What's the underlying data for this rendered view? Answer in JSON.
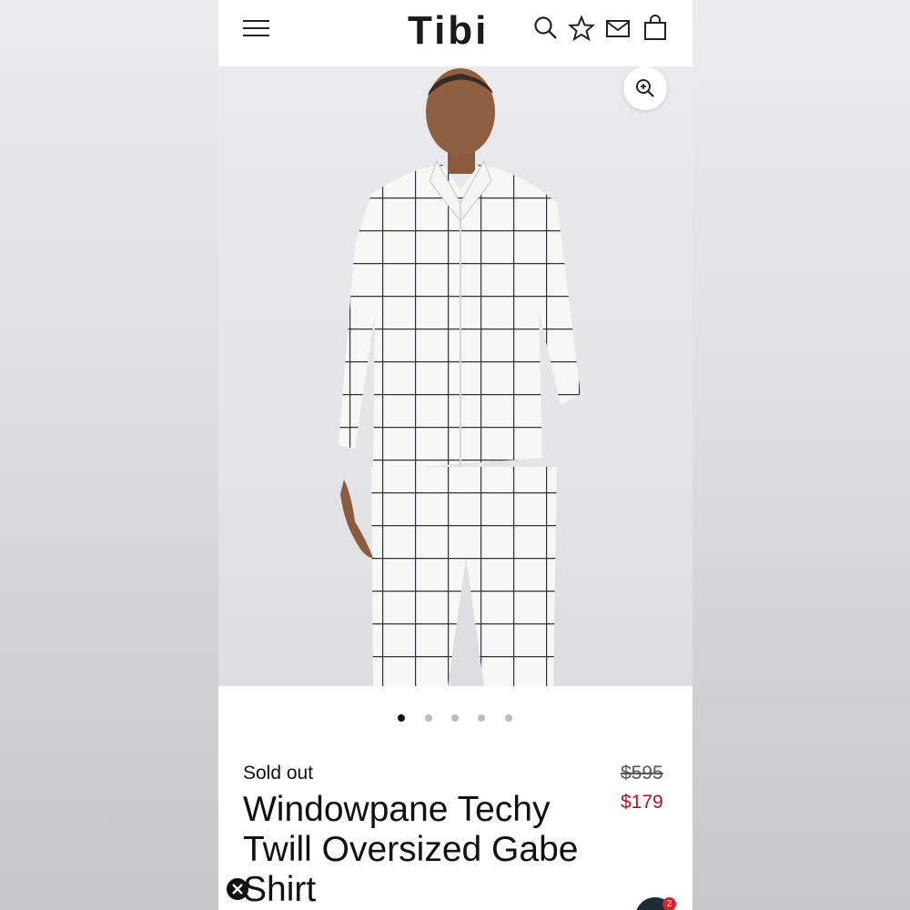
{
  "header": {
    "brand": "Tibi",
    "icons": [
      "menu-icon",
      "search-icon",
      "star-icon",
      "mail-icon",
      "bag-icon"
    ]
  },
  "gallery": {
    "zoom_icon": "zoom-in-icon",
    "dots_total": 5,
    "active_index": 0
  },
  "product": {
    "status": "Sold out",
    "title": "Windowpane Techy Twill Oversized Gabe Shirt",
    "price_original": "$595",
    "price_sale": "$179"
  },
  "chat": {
    "badge_count": "2"
  },
  "colors": {
    "sale_price": "#b5121b",
    "text": "#111111",
    "badge": "#d8232a"
  }
}
